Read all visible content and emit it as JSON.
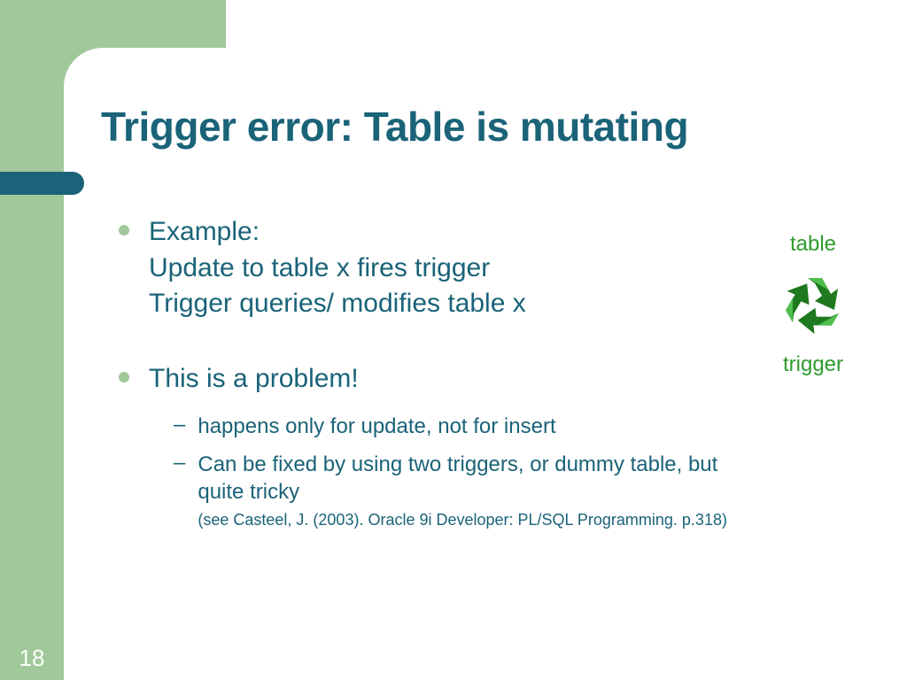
{
  "title": "Trigger error: Table is mutating",
  "bullets": [
    {
      "text": "Example:\nUpdate to table x fires trigger\nTrigger queries/ modifies table x"
    },
    {
      "text": "This is a problem!",
      "subs": [
        {
          "text": "happens only for update, not for insert"
        },
        {
          "text": "Can be fixed by using two triggers, or dummy table, but quite tricky",
          "citation": "(see Casteel, J. (2003). Oracle 9i Developer: PL/SQL Programming. p.318)"
        }
      ]
    }
  ],
  "graphic": {
    "top_label": "table",
    "bottom_label": "trigger"
  },
  "page_number": "18"
}
